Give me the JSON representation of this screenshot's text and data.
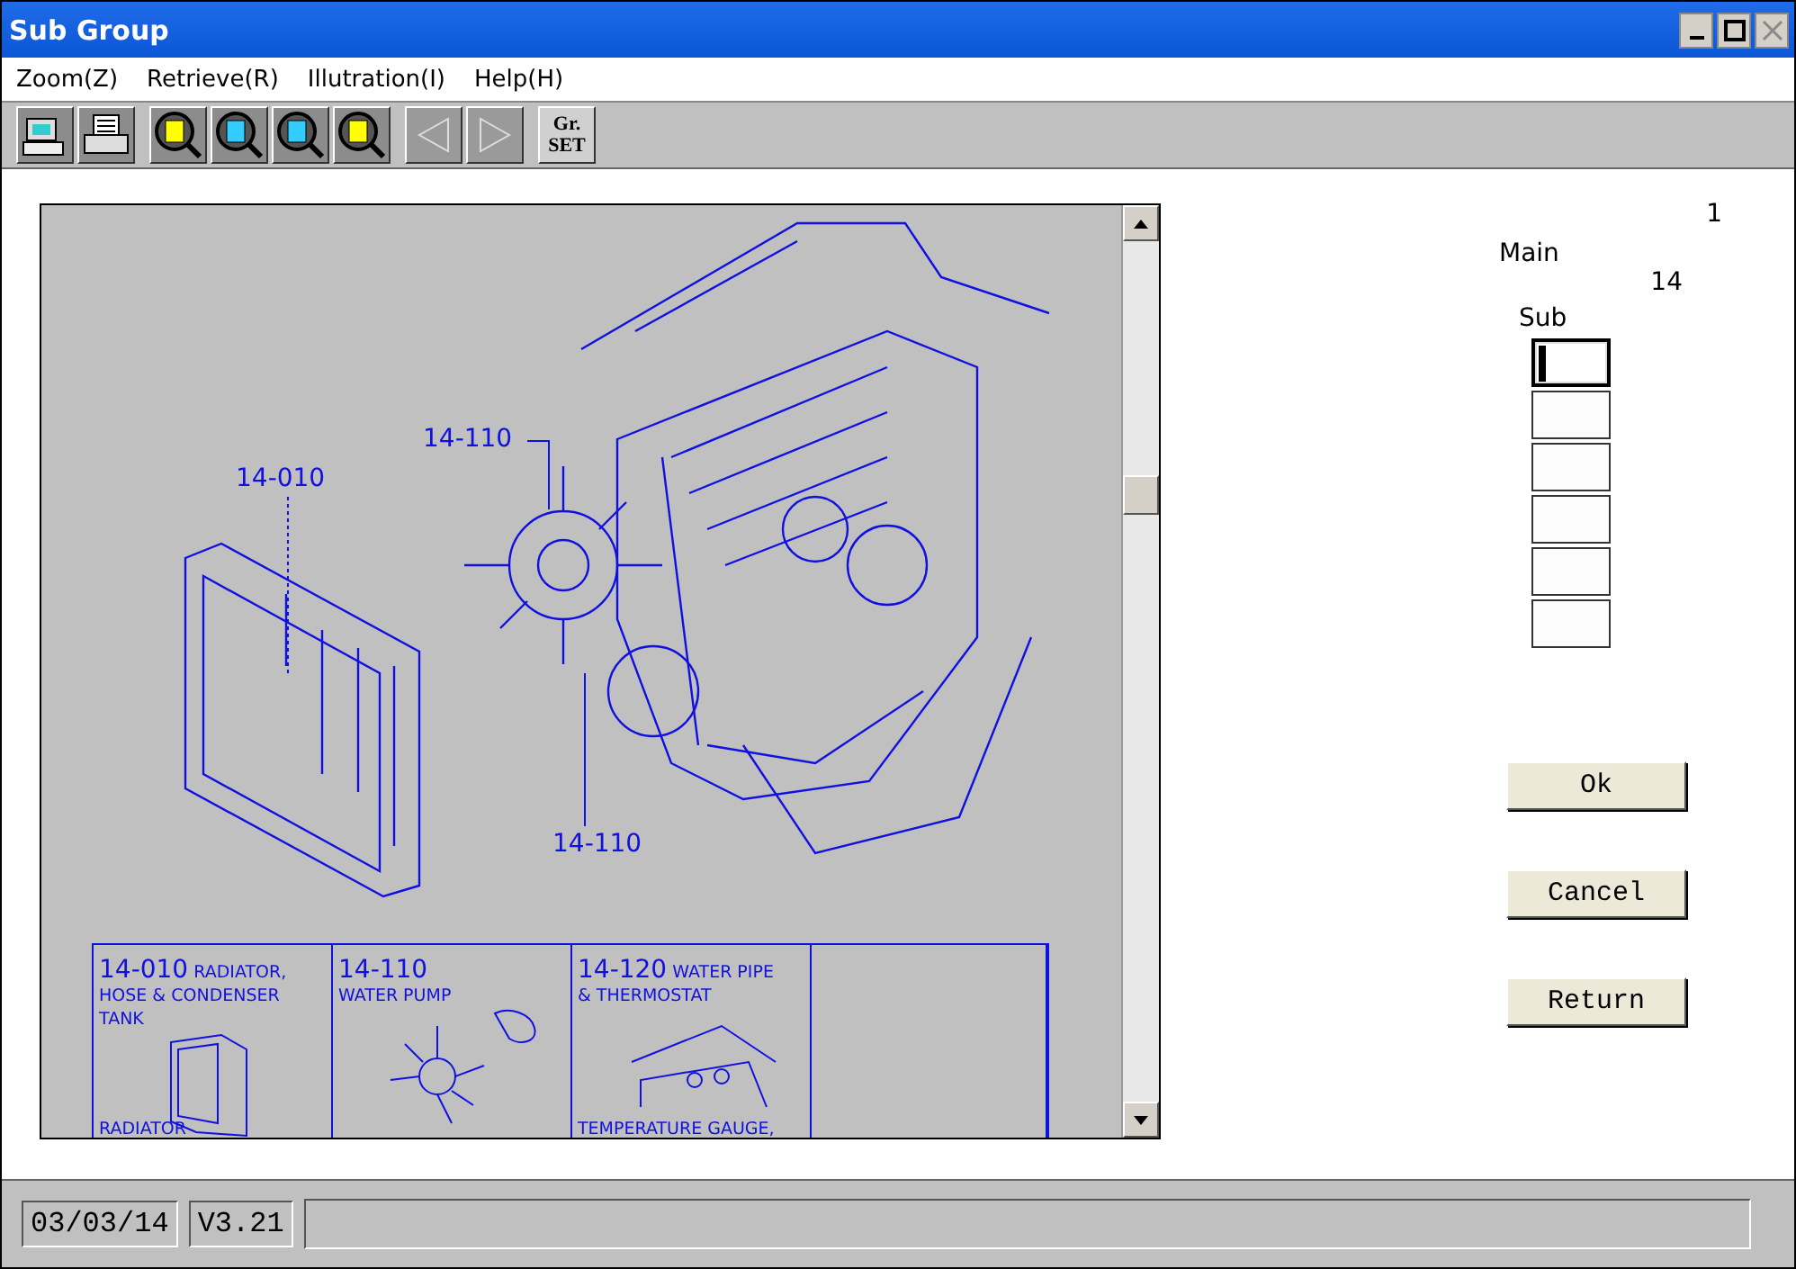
{
  "window": {
    "title": "Sub Group"
  },
  "menu": [
    "Zoom(Z)",
    "Retrieve(R)",
    "Illutration(I)",
    "Help(H)"
  ],
  "toolbar": {
    "tools": [
      {
        "kind": "monitor"
      },
      {
        "kind": "printer"
      },
      {
        "kind": "zoom-yellow"
      },
      {
        "kind": "zoom-cyan"
      },
      {
        "kind": "zoom-cyan"
      },
      {
        "kind": "zoom-yellow"
      }
    ],
    "nav": [
      {
        "kind": "left",
        "disabled": true
      },
      {
        "kind": "right",
        "disabled": true
      }
    ],
    "set_button": [
      "Gr.",
      "SET"
    ]
  },
  "illustration": {
    "callouts": [
      {
        "text": "14-110",
        "kind": "top"
      },
      {
        "text": "14-010",
        "kind": "radiator"
      },
      {
        "text": "14-110",
        "kind": "bottom"
      }
    ],
    "index": [
      {
        "code": "14-010",
        "title": "RADIATOR,",
        "subtitle": "HOSE & CONDENSER TANK",
        "caption": "RADIATOR",
        "kind": "radiator"
      },
      {
        "code": "14-110",
        "subtitle": "WATER PUMP",
        "kind": "fan"
      },
      {
        "code": "14-120",
        "title": "WATER PIPE",
        "subtitle": "& THERMOSTAT",
        "caption": "TEMPERATURE GAUGE,",
        "kind": "pipe"
      }
    ]
  },
  "selection": {
    "group": "1",
    "main": {
      "label": "Main",
      "value": "14"
    },
    "sub": {
      "label": "Sub",
      "fields": [
        {
          "focused": true
        },
        {
          "focused": false
        },
        {
          "focused": false
        },
        {
          "focused": false
        },
        {
          "focused": false
        },
        {
          "focused": false
        }
      ]
    },
    "buttons": [
      "Ok",
      "Cancel",
      "Return"
    ]
  },
  "status_bar": {
    "date": "03/03/14",
    "version": "V3.21"
  }
}
